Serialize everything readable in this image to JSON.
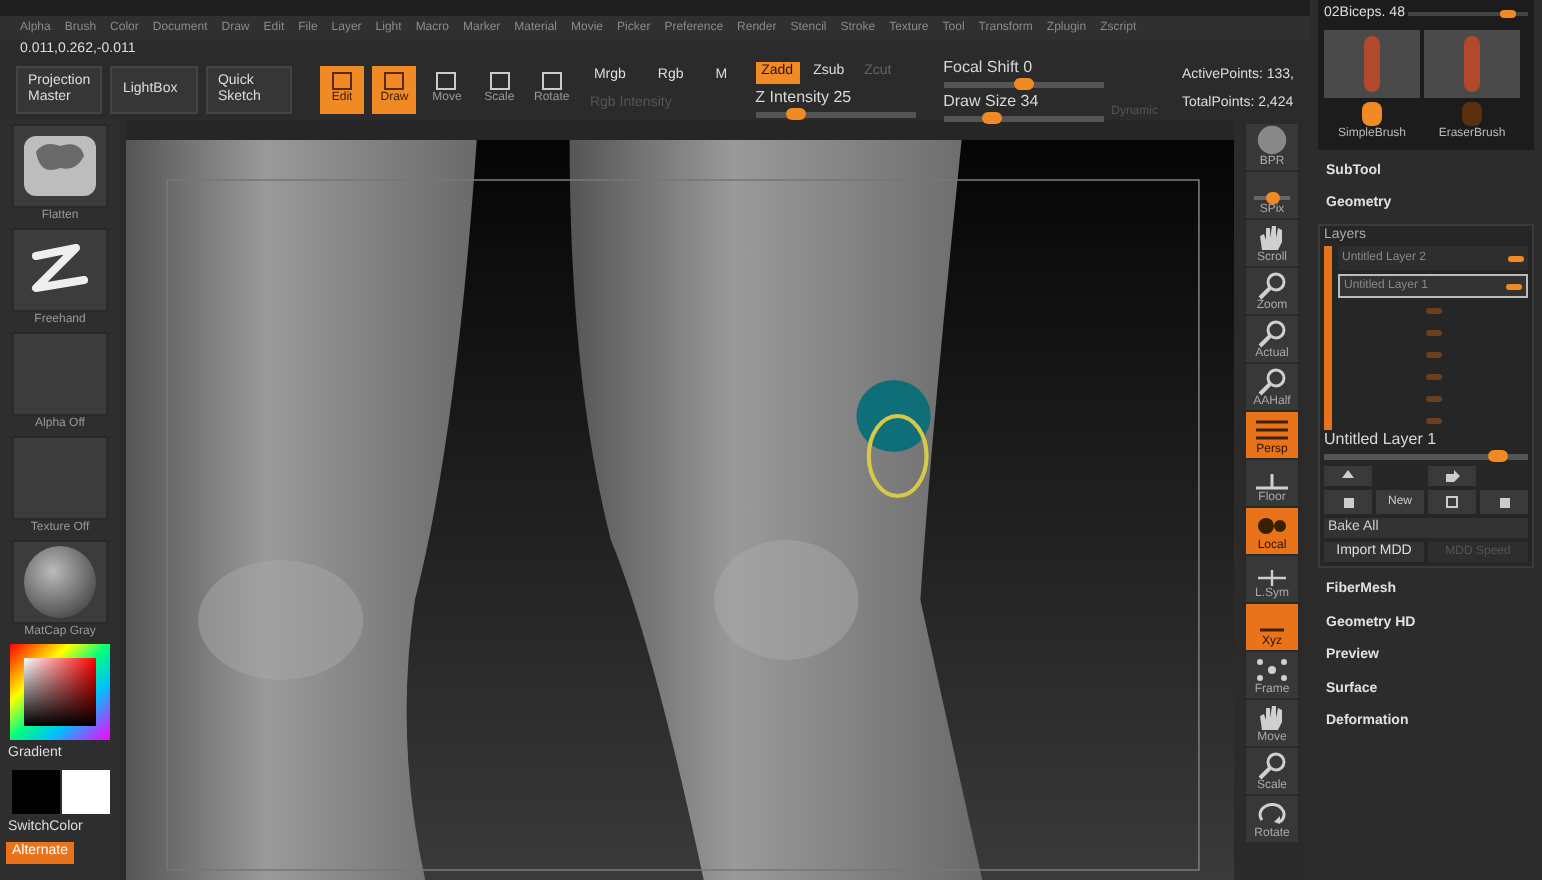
{
  "menu": [
    "Alpha",
    "Brush",
    "Color",
    "Document",
    "Draw",
    "Edit",
    "File",
    "Layer",
    "Light",
    "Macro",
    "Marker",
    "Material",
    "Movie",
    "Picker",
    "Preference",
    "Render",
    "Stencil",
    "Stroke",
    "Texture",
    "Tool",
    "Transform",
    "Zplugin",
    "Zscript"
  ],
  "coordinates": "0.011,0.262,-0.011",
  "toolbar": {
    "panels": [
      "Projection Master",
      "LightBox",
      "Quick Sketch"
    ],
    "modes": [
      {
        "label": "Edit",
        "selected": true
      },
      {
        "label": "Draw",
        "selected": true
      },
      {
        "label": "Move",
        "selected": false
      },
      {
        "label": "Scale",
        "selected": false
      },
      {
        "label": "Rotate",
        "selected": false
      }
    ],
    "color_modes": [
      {
        "label": "Mrgb",
        "selected": false
      },
      {
        "label": "Rgb",
        "selected": false
      },
      {
        "label": "M",
        "selected": false
      }
    ],
    "rgb_intensity": {
      "label": "Rgb Intensity",
      "disabled": true
    },
    "z_modes": [
      {
        "label": "Zadd",
        "selected": true,
        "disabled": false
      },
      {
        "label": "Zsub",
        "selected": false,
        "disabled": false
      },
      {
        "label": "Zcut",
        "selected": false,
        "disabled": true
      }
    ],
    "z_intensity": {
      "label": "Z Intensity 25",
      "level": 0.25
    },
    "focal_shift": {
      "label": "Focal Shift 0",
      "level": 0.5
    },
    "draw_size": {
      "label": "Draw Size 34",
      "level": 0.3
    },
    "dynamic": {
      "label": "Dynamic",
      "disabled": true
    },
    "active_points": "ActivePoints: 133,",
    "total_points": "TotalPoints: 2,424"
  },
  "left_shelf": {
    "tiles": [
      {
        "label": "Flatten",
        "kind": "blob"
      },
      {
        "label": "Freehand",
        "kind": "stroke"
      },
      {
        "label": "Alpha Off",
        "kind": "empty"
      },
      {
        "label": "Texture Off",
        "kind": "empty"
      },
      {
        "label": "MatCap Gray",
        "kind": "sphere"
      }
    ],
    "gradient": "Gradient",
    "switch_color": "SwitchColor",
    "alternate": {
      "label": "Alternate",
      "selected": true
    }
  },
  "right_shelf": [
    {
      "label": "BPR",
      "kind": "sphere",
      "selected": false
    },
    {
      "label": "SPix",
      "kind": "slider",
      "selected": false
    },
    {
      "label": "Scroll",
      "kind": "hand",
      "selected": false
    },
    {
      "label": "Zoom",
      "kind": "zoom",
      "selected": false
    },
    {
      "label": "Actual",
      "kind": "zoom",
      "selected": false
    },
    {
      "label": "AAHalf",
      "kind": "zoom",
      "selected": false
    },
    {
      "label": "Persp",
      "kind": "grid",
      "selected": true
    },
    {
      "label": "Floor",
      "kind": "floor",
      "selected": false
    },
    {
      "label": "Local",
      "kind": "local",
      "selected": true
    },
    {
      "label": "L.Sym",
      "kind": "sym",
      "selected": false
    },
    {
      "label": "Xyz",
      "kind": "axis",
      "selected": true
    },
    {
      "label": "Frame",
      "kind": "frame",
      "selected": false
    },
    {
      "label": "Move",
      "kind": "hand",
      "selected": false
    },
    {
      "label": "Scale",
      "kind": "zoom",
      "selected": false
    },
    {
      "label": "Rotate",
      "kind": "rotate",
      "selected": false
    }
  ],
  "tray": {
    "tool": {
      "name": "02Biceps. 48",
      "level": 0.9
    },
    "brushes": [
      "SimpleBrush",
      "EraserBrush"
    ],
    "palettes_top": [
      "SubTool",
      "Geometry"
    ],
    "layers": {
      "title": "Layers",
      "items": [
        {
          "label": "Untitled Layer 2",
          "selected": false
        },
        {
          "label": "Untitled Layer 1",
          "selected": true
        }
      ],
      "current": {
        "label": "Untitled Layer 1",
        "level": 0.85
      },
      "new_button": "New",
      "bake_all": "Bake All",
      "import_mdd": "Import MDD",
      "mdd_speed": {
        "label": "MDD Speed",
        "disabled": true
      }
    },
    "palettes_bottom": [
      "FiberMesh",
      "Geometry HD",
      "Preview",
      "Surface",
      "Deformation"
    ]
  }
}
